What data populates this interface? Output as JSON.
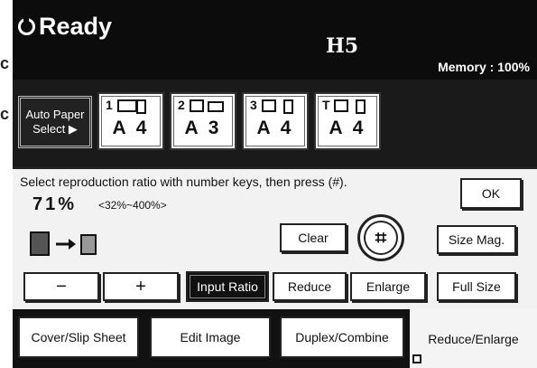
{
  "edge": {
    "fragment_top": "c",
    "fragment_bottom": "c"
  },
  "header": {
    "status": "Ready",
    "code": "H5",
    "memory": "Memory : 100%"
  },
  "paper": {
    "auto_line1": "Auto Paper",
    "auto_line2": "Select ▶",
    "trays": [
      {
        "num": "1",
        "size": "A 4"
      },
      {
        "num": "2",
        "size": "A 3"
      },
      {
        "num": "3",
        "size": "A 4"
      },
      {
        "num": "T",
        "size": "A 4"
      }
    ]
  },
  "panel": {
    "instruction": "Select reproduction ratio with number keys, then press (#).",
    "ok": "OK",
    "ratio": "71%",
    "range": "<32%~400%>",
    "clear": "Clear",
    "start_symbol": "⌗",
    "size_mag": "Size Mag.",
    "minus": "−",
    "plus": "+",
    "input_ratio": "Input Ratio",
    "reduce": "Reduce",
    "enlarge": "Enlarge",
    "full_size": "Full Size"
  },
  "tabs": [
    "Cover/Slip Sheet",
    "Edit Image",
    "Duplex/Combine",
    "Reduce/Enlarge"
  ]
}
